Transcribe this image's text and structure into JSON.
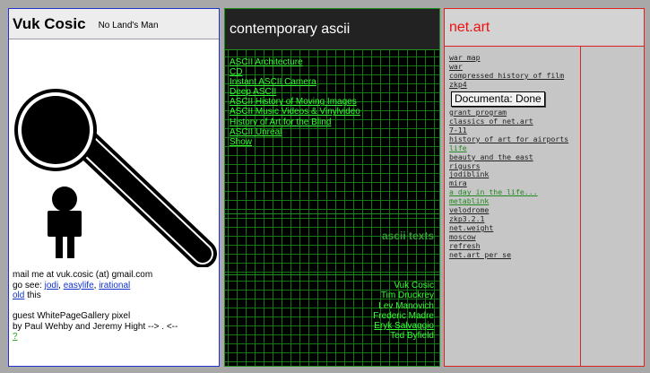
{
  "left": {
    "title": "Vuk Cosic",
    "subtitle": "No Land's Man",
    "mail": "mail me at vuk.cosic (at) gmail.com",
    "gosee_label": "go see:",
    "gosee_links": [
      "jodi",
      "easylife",
      "irational"
    ],
    "old_link": "old",
    "old_suffix": " this",
    "guest_line1": "guest WhitePageGallery pixel",
    "guest_line2": "by Paul Wehby and Jeremy Hight --> . <--",
    "question_link": "?"
  },
  "middle": {
    "title": "contemporary ascii",
    "links": [
      "ASCII Architecture",
      "CD",
      "Instant ASCII Camera",
      "Deep ASCII",
      "ASCII History of Moving Images",
      "ASCII Music Videos & Vinylvideo",
      "History of Art for the Blind",
      "ASCII Unreal",
      "Show"
    ],
    "section_label": "ascii texts",
    "authors": [
      {
        "name": "Vuk Cosic",
        "link": false
      },
      {
        "name": "Tim Druckrey",
        "link": false
      },
      {
        "name": "Lev Manovich",
        "link": false
      },
      {
        "name": "Frederic Madre",
        "link": false
      },
      {
        "name": "Eryk Salvaggio",
        "link": true
      },
      {
        "name": "Ted Byfield",
        "link": false
      }
    ]
  },
  "right": {
    "title": "net.art",
    "links_before": [
      "war map",
      "war",
      "compressed history of film",
      "zkp4"
    ],
    "status": "Documenta: Done",
    "links_after": [
      "grant program",
      "classics of net.art",
      "7-11",
      "history of art for airports",
      "life",
      "beauty and the east",
      "rigusrs",
      "jodiblink",
      "mira",
      "a day in the life...",
      "metablink",
      "velodrome",
      "zkp3.2.1",
      "net.weight",
      "moscow",
      "refresh",
      "net.art per se"
    ],
    "green_after": [
      "life",
      "a day in the life...",
      "metablink"
    ]
  },
  "colors": {
    "left_border": "#2233cc",
    "mid_grid": "#1f8f1f",
    "mid_link": "#33ff33",
    "right_border": "#dd2222",
    "right_title": "#ee1111"
  }
}
